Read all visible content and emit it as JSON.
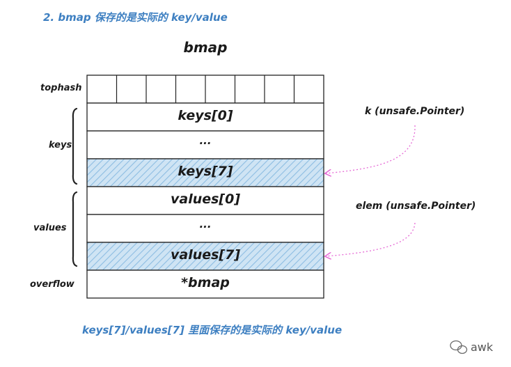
{
  "heading": "2. bmap 保存的是实际的 key/value",
  "title": "bmap",
  "sections": {
    "tophash": "tophash",
    "keys": "keys",
    "values": "values",
    "overflow": "overflow"
  },
  "rows": {
    "keys_0": "keys[0]",
    "keys_ellipsis": "...",
    "keys_7": "keys[7]",
    "values_0": "values[0]",
    "values_ellipsis": "...",
    "values_7": "values[7]",
    "overflow": "*bmap"
  },
  "annotations": {
    "key_pointer": "k (unsafe.Pointer)",
    "elem_pointer": "elem (unsafe.Pointer)"
  },
  "footnote": "keys[7]/values[7] 里面保存的是实际的 key/value",
  "watermark": "awk",
  "colors": {
    "accent_text": "#3d7fc1",
    "hatch_fill": "#bcd9ef",
    "hatch_line": "#7fb3dc",
    "arrow": "#e66ad6"
  }
}
